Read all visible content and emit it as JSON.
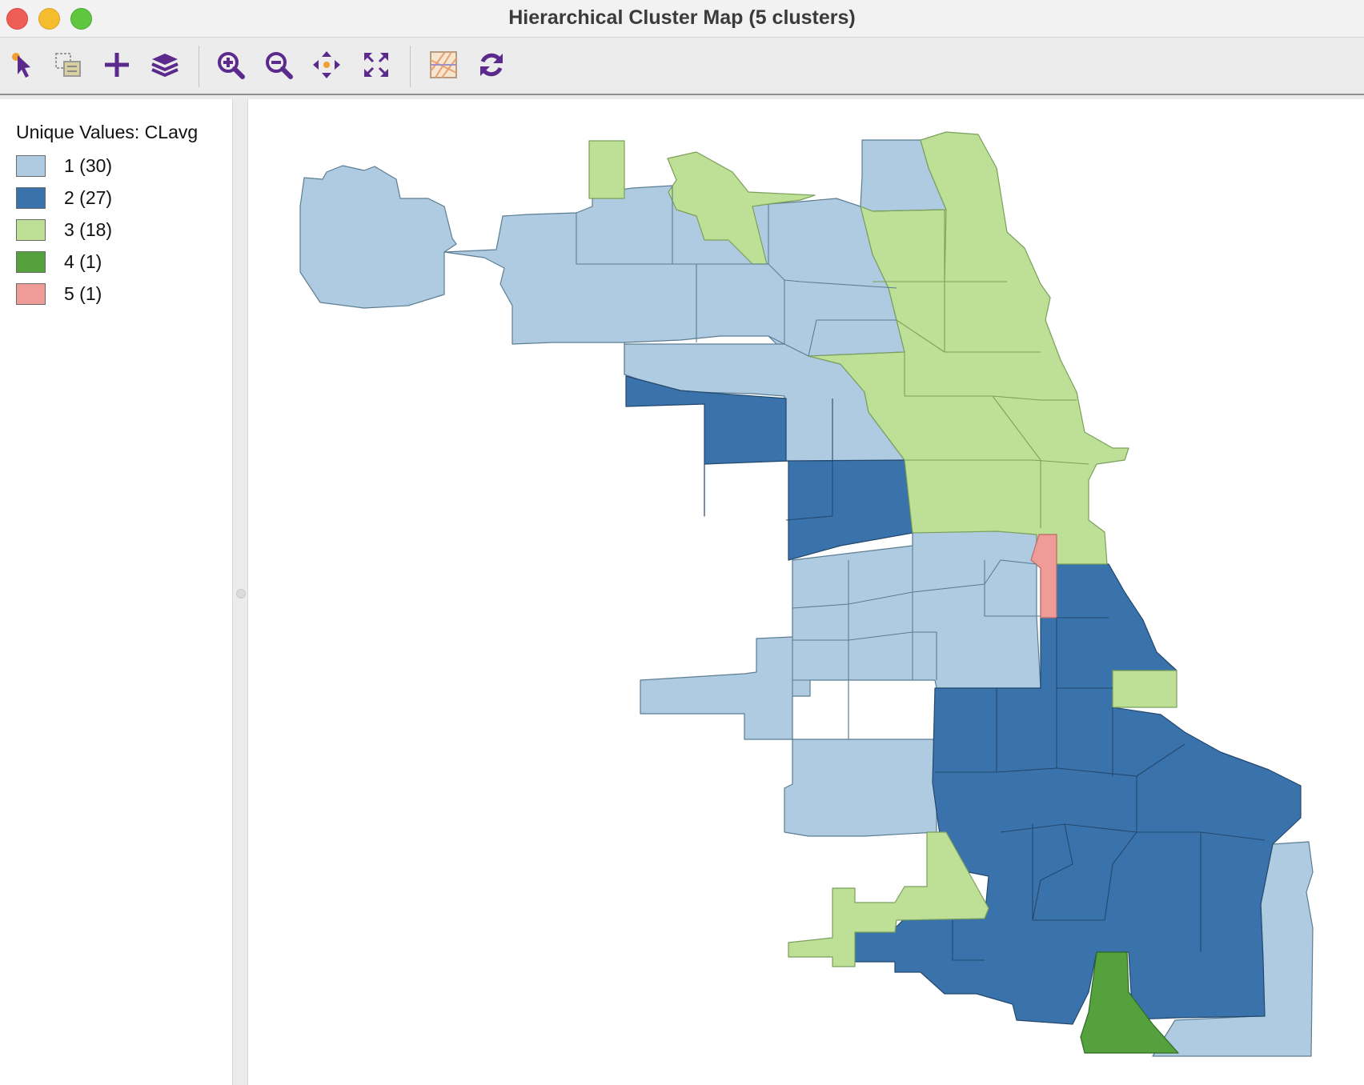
{
  "window": {
    "title": "Hierarchical Cluster Map (5 clusters)"
  },
  "toolbar": {
    "buttons": [
      {
        "name": "select-tool",
        "icon": "pointer-select-icon"
      },
      {
        "name": "selection-shape",
        "icon": "selection-shape-icon"
      },
      {
        "name": "add-layer",
        "icon": "plus-icon"
      },
      {
        "name": "layers",
        "icon": "layers-icon"
      },
      {
        "name": "zoom-in",
        "icon": "zoom-in-icon"
      },
      {
        "name": "zoom-out",
        "icon": "zoom-out-icon"
      },
      {
        "name": "pan",
        "icon": "pan-arrows-icon"
      },
      {
        "name": "full-extent",
        "icon": "full-extent-icon"
      },
      {
        "name": "basemap",
        "icon": "basemap-icon"
      },
      {
        "name": "refresh",
        "icon": "refresh-icon"
      }
    ]
  },
  "legend": {
    "title": "Unique Values: CLavg",
    "items": [
      {
        "label": "1 (30)",
        "color": "#afcbe1"
      },
      {
        "label": "2 (27)",
        "color": "#3a73ab"
      },
      {
        "label": "3 (18)",
        "color": "#bddf96"
      },
      {
        "label": "4 (1)",
        "color": "#54a13e"
      },
      {
        "label": "5 (1)",
        "color": "#ef9c98"
      }
    ]
  },
  "colors": {
    "cluster_1": "#afcbe1",
    "cluster_2": "#3a73ab",
    "cluster_3": "#bddf96",
    "cluster_4": "#54a13e",
    "cluster_5": "#ef9c98",
    "icon_purple": "#5b2a8c",
    "icon_orange": "#f0a030"
  }
}
